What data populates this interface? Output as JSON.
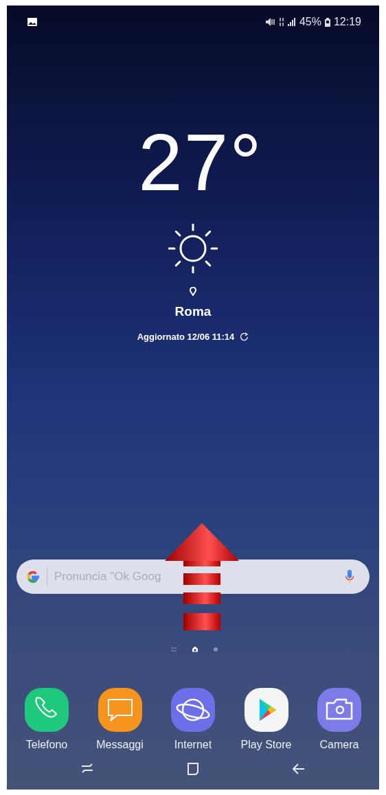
{
  "status_bar": {
    "battery_percent": "45%",
    "time": "12:19"
  },
  "weather": {
    "temperature": "27°",
    "city": "Roma",
    "updated": "Aggiornato 12/06 11:14"
  },
  "search": {
    "placeholder": "Pronuncia \"Ok Goog"
  },
  "page_indicators": [
    {
      "kind": "lines",
      "selected": false
    },
    {
      "kind": "home",
      "selected": true
    },
    {
      "kind": "dot",
      "selected": false
    }
  ],
  "dock": [
    {
      "kind": "phone",
      "label": "Telefono"
    },
    {
      "kind": "messages",
      "label": "Messaggi"
    },
    {
      "kind": "internet",
      "label": "Internet"
    },
    {
      "kind": "play",
      "label": "Play Store"
    },
    {
      "kind": "camera",
      "label": "Camera"
    }
  ],
  "nav_bar": [
    {
      "kind": "recents"
    },
    {
      "kind": "home"
    },
    {
      "kind": "back"
    }
  ]
}
